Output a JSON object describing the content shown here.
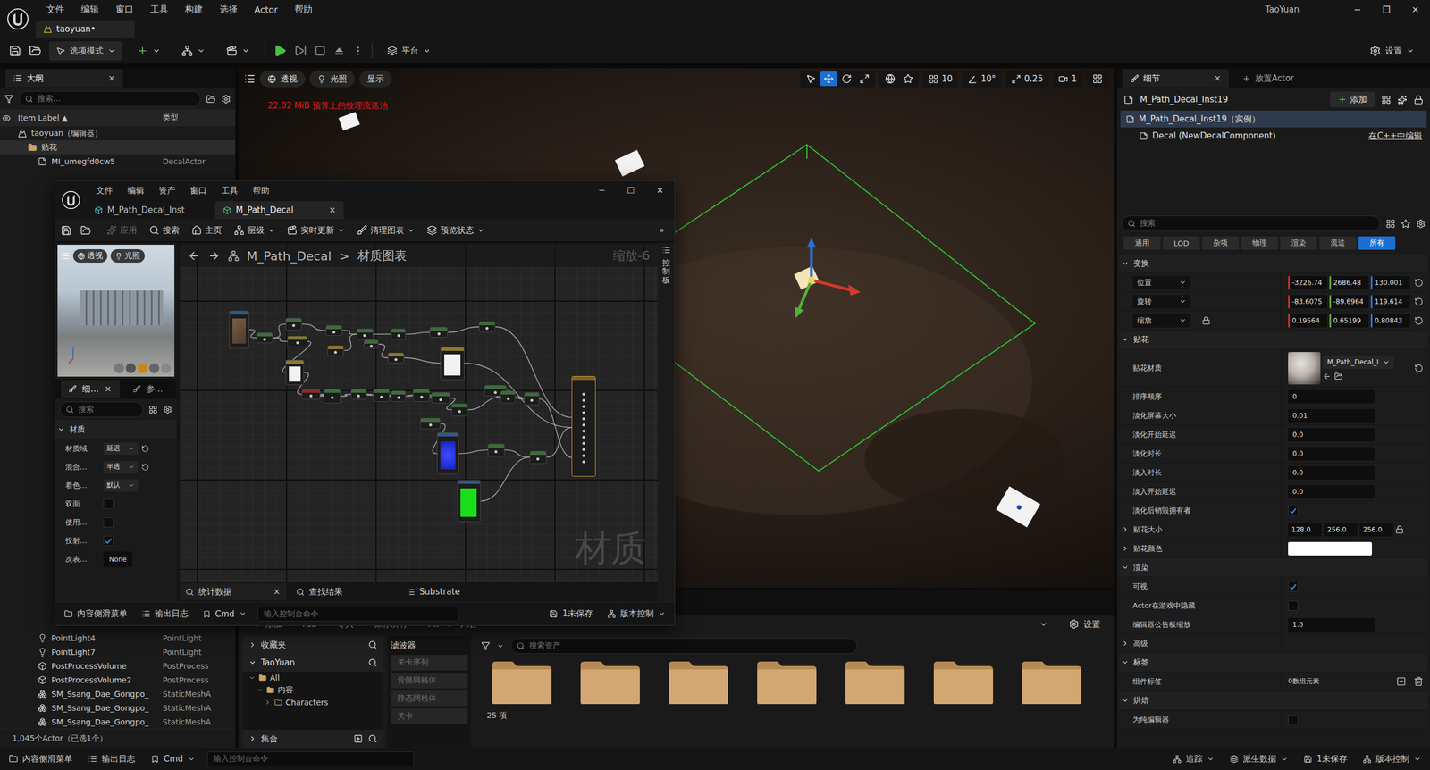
{
  "app": {
    "menu": [
      "文件",
      "编辑",
      "窗口",
      "工具",
      "构建",
      "选择",
      "Actor",
      "帮助"
    ],
    "level_tab": "taoyuan•",
    "user": "TaoYuan",
    "window_controls": [
      "─",
      "❐",
      "✕"
    ]
  },
  "toolbar": {
    "mode": "选项模式",
    "platform": "平台",
    "settings": "设置"
  },
  "outliner": {
    "title": "大纲",
    "close": "×",
    "search_placeholder": "搜索...",
    "columns": [
      "Item Label ▲",
      "类型"
    ],
    "rows_top": [
      {
        "label": "taoyuan（编辑器）",
        "type": "",
        "depth": 0,
        "kind": "level"
      },
      {
        "label": "贴花",
        "type": "",
        "depth": 1,
        "kind": "folder"
      },
      {
        "label": "MI_umegfd0cw5",
        "type": "DecalActor",
        "depth": 2,
        "kind": "decal"
      }
    ],
    "rows_bottom": [
      {
        "label": "PointLight4",
        "type": "PointLight",
        "depth": 2,
        "kind": "light"
      },
      {
        "label": "PointLight7",
        "type": "PointLight",
        "depth": 2,
        "kind": "light"
      },
      {
        "label": "PostProcessVolume",
        "type": "PostProcess",
        "depth": 2,
        "kind": "volume"
      },
      {
        "label": "PostProcessVolume2",
        "type": "PostProcess",
        "depth": 2,
        "kind": "volume"
      },
      {
        "label": "SM_Ssang_Dae_Gongpo_",
        "type": "StaticMeshA",
        "depth": 2,
        "kind": "mesh"
      },
      {
        "label": "SM_Ssang_Dae_Gongpo_",
        "type": "StaticMeshA",
        "depth": 2,
        "kind": "mesh"
      },
      {
        "label": "SM_Ssang_Dae_Gongpo_",
        "type": "StaticMeshA",
        "depth": 2,
        "kind": "mesh"
      }
    ],
    "footer": "1,045个Actor（已选1个）"
  },
  "viewport": {
    "buttons": [
      "透视",
      "光照",
      "显示"
    ],
    "warning": "22.02 MiB 预算上的纹理流送池",
    "transform_tools": [
      {
        "kind": "select",
        "selected": false
      },
      {
        "kind": "move",
        "selected": true
      },
      {
        "kind": "rotate",
        "selected": false
      },
      {
        "kind": "scale",
        "selected": false
      }
    ],
    "snaps": [
      {
        "label": "10",
        "kind": "grid"
      },
      {
        "label": "10°",
        "kind": "angle"
      },
      {
        "label": "0.25",
        "kind": "scale"
      },
      {
        "label": "1",
        "kind": "camera"
      }
    ]
  },
  "details": {
    "tabs": [
      {
        "label": "细节",
        "close": "×",
        "selected": true
      },
      {
        "label": "放置Actor",
        "close": "",
        "selected": false
      }
    ],
    "actor": "M_Path_Decal_Inst19",
    "add": "添加",
    "components": [
      {
        "label": "M_Path_Decal_Inst19（实例）",
        "depth": 0,
        "selected": true,
        "link": ""
      },
      {
        "label": "Decal (NewDecalComponent)",
        "depth": 1,
        "selected": false,
        "link": "在C++中编辑"
      }
    ],
    "search_placeholder": "搜索",
    "filters": [
      {
        "label": "通用",
        "selected": false
      },
      {
        "label": "LOD",
        "selected": false
      },
      {
        "label": "杂项",
        "selected": false
      },
      {
        "label": "物理",
        "selected": false
      },
      {
        "label": "渲染",
        "selected": false
      },
      {
        "label": "流送",
        "selected": false
      },
      {
        "label": "所有",
        "selected": true
      }
    ],
    "sections": [
      {
        "title": "变换",
        "expanded": true,
        "rows": [
          {
            "kind": "vector",
            "label": "位置",
            "values": [
              "-3226.74",
              "2686.48",
              "130.001"
            ],
            "lock": false,
            "reset": true
          },
          {
            "kind": "vector",
            "label": "旋转",
            "values": [
              "-83.6075",
              "-89.6964",
              "119.614"
            ],
            "lock": false,
            "reset": true
          },
          {
            "kind": "vector",
            "label": "缩放",
            "values": [
              "0.19564",
              "0.65199",
              "0.80843"
            ],
            "lock": true,
            "reset": true
          }
        ]
      },
      {
        "title": "贴花",
        "expanded": true,
        "rows": [
          {
            "kind": "material",
            "label": "贴花材质",
            "value": "M_Path_Decal_I",
            "reset": true
          },
          {
            "kind": "number",
            "label": "排序顺序",
            "value": "0"
          },
          {
            "kind": "number",
            "label": "淡化屏幕大小",
            "value": "0.01"
          },
          {
            "kind": "number",
            "label": "淡化开始延迟",
            "value": "0.0"
          },
          {
            "kind": "number",
            "label": "淡化时长",
            "value": "0.0"
          },
          {
            "kind": "number",
            "label": "淡入时长",
            "value": "0.0"
          },
          {
            "kind": "number",
            "label": "淡入开始延迟",
            "value": "0.0"
          },
          {
            "kind": "checkbox",
            "label": "淡化后销毁拥有者",
            "checked": true
          },
          {
            "kind": "size",
            "label": "贴花大小",
            "values": [
              "128.0",
              "256.0",
              "256.0"
            ],
            "lock": true,
            "expanded": false
          },
          {
            "kind": "color",
            "label": "贴花颜色",
            "color": "#ffffff",
            "expanded": false
          }
        ]
      },
      {
        "title": "渲染",
        "expanded": true,
        "rows": [
          {
            "kind": "checkbox",
            "label": "可视",
            "checked": true
          },
          {
            "kind": "checkbox",
            "label": "Actor在游戏中隐藏",
            "checked": false
          },
          {
            "kind": "number",
            "label": "编辑器公告板缩放",
            "value": "1.0"
          },
          {
            "kind": "group",
            "label": "高级",
            "expanded": false
          }
        ]
      },
      {
        "title": "标签",
        "expanded": true,
        "rows": [
          {
            "kind": "array",
            "label": "组件标签",
            "value": "0数组元素"
          }
        ]
      },
      {
        "title": "烘焙",
        "expanded": true,
        "rows": [
          {
            "kind": "checkbox",
            "label": "为纯编辑器",
            "checked": false
          }
        ]
      }
    ]
  },
  "content_browser": {
    "toolbar": [
      "添加",
      "Fab",
      "导入",
      "保存所有"
    ],
    "path": [
      "All",
      "内容"
    ],
    "settings": "设置",
    "favorites": "收藏夹",
    "project": "TaoYuan",
    "tree": [
      {
        "label": "All",
        "depth": 0,
        "expanded": true
      },
      {
        "label": "内容",
        "depth": 1,
        "expanded": true
      },
      {
        "label": "Characters",
        "depth": 2,
        "expanded": false
      }
    ],
    "collections": "集合",
    "filters_title": "滤波器",
    "filters": [
      "关卡序列",
      "骨骼网格体",
      "静态网格体",
      "关卡"
    ],
    "search_placeholder": "搜索资产",
    "folders": [
      {
        "kind": "folder"
      },
      {
        "kind": "folder"
      },
      {
        "kind": "folder"
      },
      {
        "kind": "folder"
      },
      {
        "kind": "folder"
      },
      {
        "kind": "folder"
      },
      {
        "kind": "folder"
      }
    ],
    "count": "25 项"
  },
  "status_bar": {
    "left": [
      "内容侧滑菜单",
      "输出日志"
    ],
    "cmd": "Cmd",
    "console_placeholder": "输入控制台命令",
    "right": [
      "追踪",
      "派生数据",
      "1未保存",
      "版本控制"
    ]
  },
  "material_editor": {
    "menu": [
      "文件",
      "编辑",
      "资产",
      "窗口",
      "工具",
      "帮助"
    ],
    "window_controls": [
      "─",
      "☐",
      "✕"
    ],
    "tabs": [
      {
        "label": "M_Path_Decal_Inst",
        "selected": false,
        "close": ""
      },
      {
        "label": "M_Path_Decal",
        "selected": true,
        "close": "×"
      }
    ],
    "toolbar": [
      {
        "label": "应用",
        "kind": "apply",
        "disabled": true,
        "dropdown": false
      },
      {
        "label": "搜索",
        "kind": "search",
        "disabled": false,
        "dropdown": false
      },
      {
        "label": "主页",
        "kind": "home",
        "disabled": false,
        "dropdown": false
      },
      {
        "label": "层级",
        "kind": "hierarchy",
        "disabled": false,
        "dropdown": true
      },
      {
        "label": "实时更新",
        "kind": "live",
        "disabled": false,
        "dropdown": true
      },
      {
        "label": "清理图表",
        "kind": "clean",
        "disabled": false,
        "dropdown": true
      },
      {
        "label": "预览状态",
        "kind": "preview",
        "disabled": false,
        "dropdown": true
      }
    ],
    "overflow": "»",
    "preview": {
      "buttons": [
        "透视",
        "光照"
      ]
    },
    "panel_tabs": [
      {
        "label": "细…",
        "selected": true,
        "close": "×"
      },
      {
        "label": "参…",
        "selected": false,
        "close": ""
      }
    ],
    "search_placeholder": "搜索",
    "section": "材质",
    "properties": [
      {
        "label": "材质域",
        "kind": "dropdown",
        "value": "延迟",
        "reset": true
      },
      {
        "label": "混合…",
        "kind": "dropdown",
        "value": "半透",
        "reset": true
      },
      {
        "label": "着色…",
        "kind": "dropdown",
        "value": "默认",
        "reset": false
      },
      {
        "label": "双面",
        "kind": "checkbox",
        "checked": false
      },
      {
        "label": "使用…",
        "kind": "checkbox",
        "checked": false
      },
      {
        "label": "投射…",
        "kind": "checkbox",
        "checked": true
      },
      {
        "label": "次表…",
        "kind": "text",
        "value": "None"
      }
    ],
    "graph": {
      "breadcrumb": [
        "M_Path_Decal",
        "材质图表"
      ],
      "separator": ">",
      "zoom": "缩放-6",
      "watermark": "材质",
      "nodes": [
        {
          "kind": "texture",
          "color": "#2f5a86"
        },
        {
          "kind": "small",
          "color": "#3d6b3a"
        },
        {
          "kind": "small",
          "color": "#3d6b3a"
        },
        {
          "kind": "small",
          "color": "#8a7a2a"
        },
        {
          "kind": "white",
          "color": "#8a7a2a"
        },
        {
          "kind": "small",
          "color": "#3d6b3a"
        },
        {
          "kind": "small",
          "color": "#8a7a2a"
        },
        {
          "kind": "small",
          "color": "#3d6b3a"
        },
        {
          "kind": "small",
          "color": "#3d6b3a"
        },
        {
          "kind": "small",
          "color": "#3d6b3a"
        },
        {
          "kind": "small",
          "color": "#8a7a2a"
        },
        {
          "kind": "small",
          "color": "#3d6b3a"
        },
        {
          "kind": "white",
          "color": "#8a7a2a"
        },
        {
          "kind": "small",
          "color": "#3d6b3a"
        },
        {
          "kind": "small",
          "color": "#8a2a2a"
        },
        {
          "kind": "small",
          "color": "#3d6b3a"
        },
        {
          "kind": "small",
          "color": "#3d6b3a"
        },
        {
          "kind": "small",
          "color": "#3d6b3a"
        },
        {
          "kind": "small",
          "color": "#3d6b3a"
        },
        {
          "kind": "small",
          "color": "#3d6b3a"
        },
        {
          "kind": "small",
          "color": "#3d6b3a"
        },
        {
          "kind": "small",
          "color": "#3d6b3a"
        },
        {
          "kind": "small",
          "color": "#3d6b3a"
        },
        {
          "kind": "small",
          "color": "#3d6b3a"
        },
        {
          "kind": "small",
          "color": "#3d6b3a"
        },
        {
          "kind": "small",
          "color": "#3d6b3a"
        },
        {
          "kind": "blue",
          "color": "#2f5a86"
        },
        {
          "kind": "green",
          "color": "#2f5a86"
        },
        {
          "kind": "small",
          "color": "#3d6b3a"
        },
        {
          "kind": "small",
          "color": "#3d6b3a"
        },
        {
          "kind": "output",
          "color": "#7a6228"
        }
      ],
      "wires": [
        [
          0,
          1
        ],
        [
          1,
          2
        ],
        [
          1,
          3
        ],
        [
          3,
          4
        ],
        [
          2,
          5
        ],
        [
          5,
          7
        ],
        [
          6,
          7
        ],
        [
          7,
          9
        ],
        [
          9,
          11
        ],
        [
          11,
          13
        ],
        [
          10,
          12
        ],
        [
          13,
          30
        ],
        [
          12,
          30
        ],
        [
          14,
          15
        ],
        [
          15,
          16
        ],
        [
          16,
          17
        ],
        [
          17,
          18
        ],
        [
          18,
          19
        ],
        [
          19,
          20
        ],
        [
          20,
          21
        ],
        [
          21,
          23
        ],
        [
          22,
          23
        ],
        [
          23,
          24
        ],
        [
          24,
          30
        ],
        [
          25,
          26
        ],
        [
          26,
          28
        ],
        [
          27,
          29
        ],
        [
          28,
          29
        ],
        [
          29,
          30
        ],
        [
          4,
          14
        ],
        [
          8,
          10
        ]
      ]
    },
    "side_tab": "控制板",
    "bottom_tabs": [
      {
        "label": "统计数据",
        "close": "×",
        "kind": "stats"
      },
      {
        "label": "查找结果",
        "close": "",
        "kind": "find"
      },
      {
        "label": "Substrate",
        "close": "",
        "kind": "substrate"
      }
    ],
    "status": {
      "left": [
        "内容侧滑菜单",
        "输出日志"
      ],
      "cmd": "Cmd",
      "console_placeholder": "输入控制台命令",
      "right": [
        "1未保存",
        "版本控制"
      ]
    }
  }
}
